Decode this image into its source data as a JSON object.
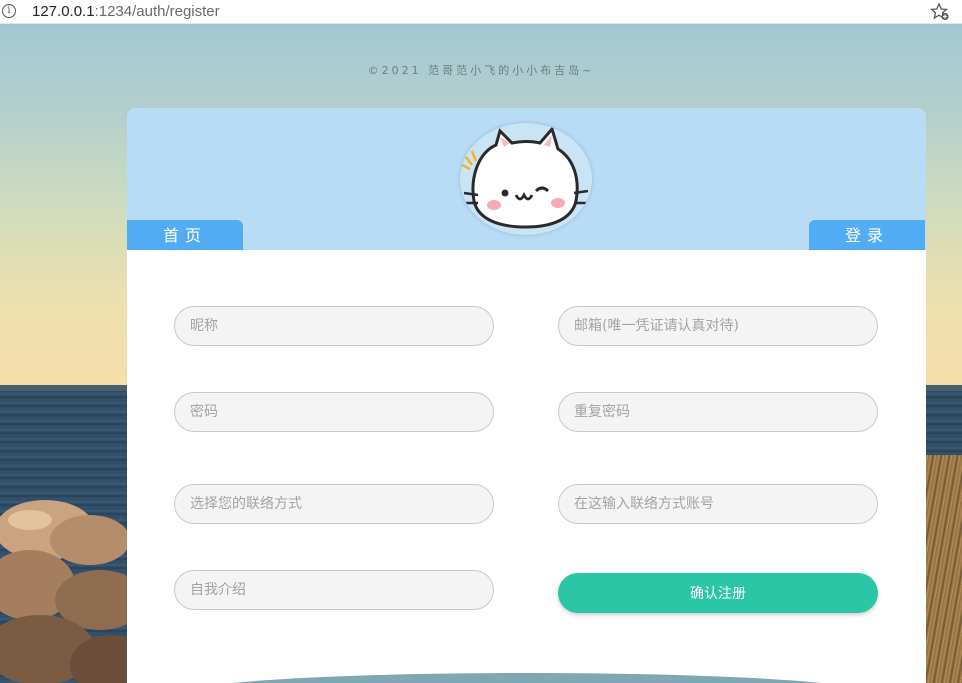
{
  "browser": {
    "url_host": "127.0.0.1",
    "url_rest": ":1234/auth/register",
    "info_icon": "info-icon",
    "star_icon": "bookmark-star-icon"
  },
  "page": {
    "credit": "©2021 范哥范小飞的小小布吉岛~",
    "tab_home": "首页",
    "tab_login": "登录"
  },
  "form": {
    "nickname_placeholder": "昵称",
    "email_placeholder": "邮箱(唯一凭证请认真对待)",
    "password_placeholder": "密码",
    "repeat_password_placeholder": "重复密码",
    "contact_method_placeholder": "选择您的联络方式",
    "contact_account_placeholder": "在这输入联络方式账号",
    "intro_placeholder": "自我介绍",
    "submit_label": "确认注册"
  },
  "colors": {
    "header_bg": "#b9dcf6",
    "tab_bg": "#51acf3",
    "submit_bg": "#2ac6a6"
  }
}
